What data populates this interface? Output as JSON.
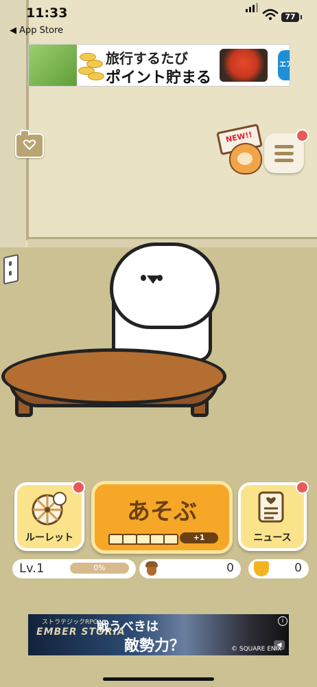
{
  "status_bar": {
    "time": "11:33",
    "back_label": "◀ App Store",
    "battery": "77"
  },
  "ad_top": {
    "line1": "旅行するたび",
    "line2": "ポイント貯まる",
    "logo": "エアトリ"
  },
  "scene": {
    "sign": "NEW!!"
  },
  "buttons": {
    "roulette_label": "ルーレット",
    "play_label": "あそぶ",
    "play_bonus": "+1",
    "news_label": "ニュース"
  },
  "stats": {
    "level": "Lv.1",
    "exp_percent": "0%",
    "exp_fraction": 0,
    "acorns": "0",
    "gold_acorns": "0"
  },
  "ad_bottom": {
    "subtitle": "ストラテジックRPG",
    "logo": "EMBER STORIA",
    "headline1": "戦うべきは",
    "headline2": "敵勢力？",
    "company": "© SQUARE ENIX",
    "info": "i"
  },
  "colors": {
    "wall": "#e9e2c4",
    "floor": "#cbc193",
    "play_button": "#f6a727",
    "side_button": "#fae38a",
    "notification_dot": "#e85a5a"
  },
  "icons": {
    "camera": "camera-icon",
    "menu": "hamburger-menu-icon",
    "roulette": "roulette-wheel-icon",
    "news": "document-icon",
    "acorn": "acorn-icon",
    "gold_acorn": "gold-acorn-icon"
  }
}
